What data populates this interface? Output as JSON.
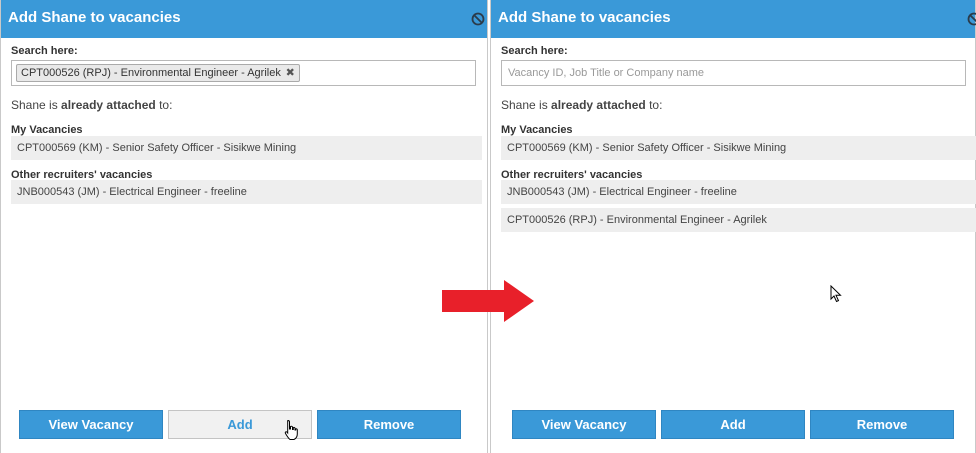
{
  "left": {
    "title": "Add Shane to vacancies",
    "search_label": "Search here:",
    "selected_chip": "CPT000526 (RPJ) - Environmental Engineer - Agrilek",
    "chip_remove": "✖",
    "attached_prefix": "Shane is ",
    "attached_bold": "already attached",
    "attached_suffix": " to:",
    "my_vacancies_label": "My Vacancies",
    "my_vacancies": [
      "CPT000569 (KM) - Senior Safety Officer - Sisikwe Mining"
    ],
    "other_label": "Other recruiters' vacancies",
    "other_vacancies": [
      "JNB000543 (JM) - Electrical Engineer - freeline"
    ],
    "buttons": {
      "view": "View Vacancy",
      "add": "Add",
      "remove": "Remove"
    }
  },
  "right": {
    "title": "Add Shane to vacancies",
    "search_label": "Search here:",
    "search_value": "",
    "search_placeholder": "Vacancy ID, Job Title or Company name",
    "attached_prefix": "Shane is ",
    "attached_bold": "already attached",
    "attached_suffix": " to:",
    "my_vacancies_label": "My Vacancies",
    "my_vacancies": [
      "CPT000569 (KM) - Senior Safety Officer - Sisikwe Mining"
    ],
    "other_label": "Other recruiters' vacancies",
    "other_vacancies": [
      "JNB000543 (JM) - Electrical Engineer - freeline",
      "CPT000526 (RPJ) - Environmental Engineer - Agrilek"
    ],
    "buttons": {
      "view": "View Vacancy",
      "add": "Add",
      "remove": "Remove"
    }
  },
  "icons": {
    "header": "block-icon",
    "transition": "right-arrow-icon"
  },
  "colors": {
    "header": "#3a99d8",
    "button": "#3a99d8",
    "arrow": "#e8202a"
  }
}
